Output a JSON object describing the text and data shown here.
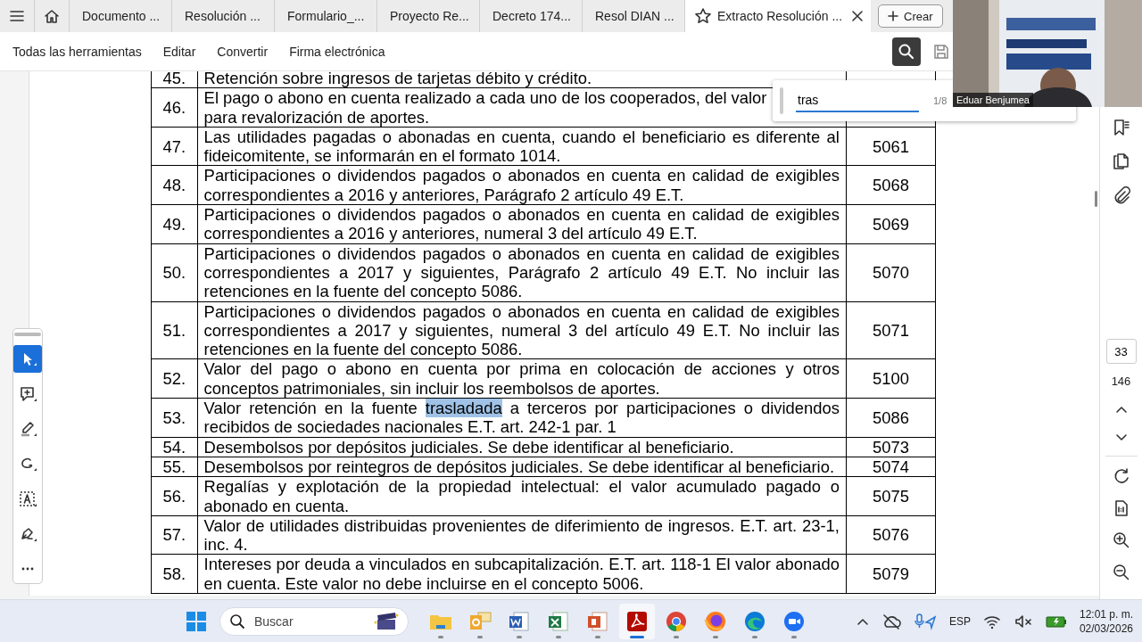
{
  "tabs": [
    {
      "label": "Documento ...",
      "selected": false
    },
    {
      "label": "Resolución ...",
      "selected": false
    },
    {
      "label": "Formulario_...",
      "selected": false
    },
    {
      "label": "Proyecto Re...",
      "selected": false
    },
    {
      "label": "Decreto 174...",
      "selected": false
    },
    {
      "label": "Resol DIAN ...",
      "selected": false
    },
    {
      "label": "Extracto Resolución ...",
      "selected": true
    }
  ],
  "create_button": {
    "label": "Crear"
  },
  "menu": [
    {
      "label": "Todas las herramientas"
    },
    {
      "label": "Editar"
    },
    {
      "label": "Convertir"
    },
    {
      "label": "Firma electrónica"
    }
  ],
  "find": {
    "value": "tras",
    "count": "1/8"
  },
  "video": {
    "kind": "picture",
    "participant": "Eduar Benjumea"
  },
  "tools": [
    {
      "kind": "select",
      "selected": true
    },
    {
      "kind": "comment",
      "selected": false
    },
    {
      "kind": "pen",
      "selected": false
    },
    {
      "kind": "lasso",
      "selected": false
    },
    {
      "kind": "text",
      "selected": false
    },
    {
      "kind": "sign",
      "selected": false
    },
    {
      "kind": "more",
      "selected": false
    }
  ],
  "table": {
    "rows": [
      {
        "number": "45.",
        "description": [
          {
            "text": "Retención sobre ingresos de tarjetas débito y crédito.",
            "highlighted": false
          }
        ],
        "code": ""
      },
      {
        "number": "46.",
        "description": [
          {
            "text": "El pago o abono en cuenta realizado a cada uno de los cooperados, del valor",
            "highlighted": false,
            "break_after": true
          },
          {
            "text": "para revalorización de aportes.",
            "highlighted": false
          }
        ],
        "code": ""
      },
      {
        "number": "47.",
        "description": [
          {
            "text": "Las utilidades pagadas o abonadas en cuenta, cuando el beneficiario es diferente al fideicomitente, se informarán en el formato 1014.",
            "highlighted": false
          }
        ],
        "code": "5061"
      },
      {
        "number": "48.",
        "description": [
          {
            "text": "Participaciones o dividendos pagados o abonados en cuenta en calidad de exigibles correspondientes a 2016 y anteriores, Parágrafo 2 artículo 49 E.T.",
            "highlighted": false
          }
        ],
        "code": "5068"
      },
      {
        "number": "49.",
        "description": [
          {
            "text": "Participaciones o dividendos pagados o abonados en cuenta en calidad de exigibles correspondientes a 2016 y anteriores, numeral 3 del artículo 49 E.T.",
            "highlighted": false
          }
        ],
        "code": "5069"
      },
      {
        "number": "50.",
        "description": [
          {
            "text": "Participaciones o dividendos pagados o abonados en cuenta en calidad de exigibles correspondientes a 2017 y siguientes, Parágrafo 2 artículo 49 E.T. No incluir las retenciones en la fuente del concepto 5086.",
            "highlighted": false
          }
        ],
        "code": "5070"
      },
      {
        "number": "51.",
        "description": [
          {
            "text": "Participaciones o dividendos pagados o abonados en cuenta en calidad de exigibles correspondientes a 2017 y siguientes, numeral 3 del artículo 49 E.T. No incluir las retenciones en la fuente del concepto 5086.",
            "highlighted": false
          }
        ],
        "code": "5071"
      },
      {
        "number": "52.",
        "description": [
          {
            "text": "Valor del pago o abono en cuenta por prima en colocación de acciones y otros conceptos patrimoniales, sin incluir los reembolsos de aportes.",
            "highlighted": false
          }
        ],
        "code": "5100"
      },
      {
        "number": "53.",
        "description": [
          {
            "text": "Valor retención en la fuente ",
            "highlighted": false
          },
          {
            "text": "trasladada",
            "highlighted": true
          },
          {
            "text": " a terceros por participaciones o dividendos recibidos de sociedades nacionales E.T. art. 242-1 par. 1",
            "highlighted": false
          }
        ],
        "code": "5086"
      },
      {
        "number": "54.",
        "description": [
          {
            "text": "Desembolsos por depósitos judiciales. Se debe identificar al beneficiario.",
            "highlighted": false
          }
        ],
        "code": "5073"
      },
      {
        "number": "55.",
        "description": [
          {
            "text": "Desembolsos por reintegros de depósitos judiciales. Se debe identificar al beneficiario.",
            "highlighted": false
          }
        ],
        "code": "5074"
      },
      {
        "number": "56.",
        "description": [
          {
            "text": "Regalías y explotación de la propiedad intelectual: el valor acumulado pagado o abonado en cuenta.",
            "highlighted": false
          }
        ],
        "code": "5075"
      },
      {
        "number": "57.",
        "description": [
          {
            "text": "Valor de utilidades distribuidas provenientes de diferimiento de ingresos. E.T. art. 23-1, inc. 4.",
            "highlighted": false
          }
        ],
        "code": "5076"
      },
      {
        "number": "58.",
        "description": [
          {
            "text": "Intereses por deuda a vinculados en subcapitalización. E.T. art. 118-1 El valor abonado en cuenta. Este valor no debe incluirse en el concepto 5006.",
            "highlighted": false
          }
        ],
        "code": "5079"
      }
    ]
  },
  "pager": {
    "current_page": "33",
    "total_pages": "146"
  },
  "taskbar": {
    "search_placeholder": "Buscar",
    "apps": [
      {
        "kind": "folder",
        "active": false
      },
      {
        "kind": "mail",
        "active": false
      },
      {
        "kind": "word",
        "active": false
      },
      {
        "kind": "sheet",
        "active": false
      },
      {
        "kind": "slides",
        "active": false
      },
      {
        "kind": "pdf",
        "active": true
      },
      {
        "kind": "chrome",
        "active": false
      },
      {
        "kind": "firefox",
        "active": false
      },
      {
        "kind": "edge",
        "active": false
      },
      {
        "kind": "video",
        "active": false
      }
    ],
    "language": "ESP",
    "time": "12:01 p. m.",
    "date": "02/03/2026"
  }
}
